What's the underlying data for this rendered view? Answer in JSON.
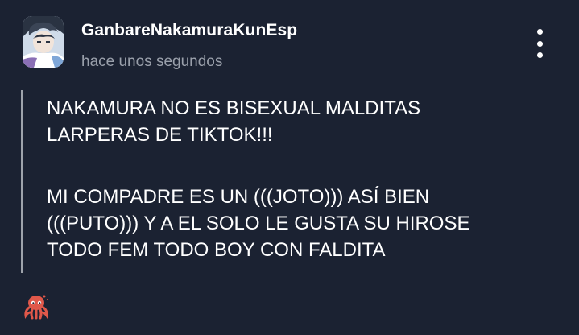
{
  "post": {
    "author": "GanbareNakamuraKunEsp",
    "timestamp": "hace unos segundos",
    "paragraphs": [
      [
        "NAKAMURA NO ES BISEXUAL MALDITAS",
        "LARPERAS DE TIKTOK!!!"
      ],
      [
        "MI COMPADRE ES UN (((JOTO))) ASÍ BIEN",
        "(((PUTO))) Y A EL SOLO LE GUSTA SU HIROSE",
        "TODO FEM TODO BOY CON FALDITA"
      ]
    ]
  },
  "icons": {
    "menu": "more-vertical-icon",
    "reaction": "octopus-icon"
  },
  "colors": {
    "background": "#1b2232",
    "text": "#ffffff",
    "muted": "#9aa0ab",
    "quote_bar": "#9ea3ab",
    "reaction": "#e0584a"
  }
}
